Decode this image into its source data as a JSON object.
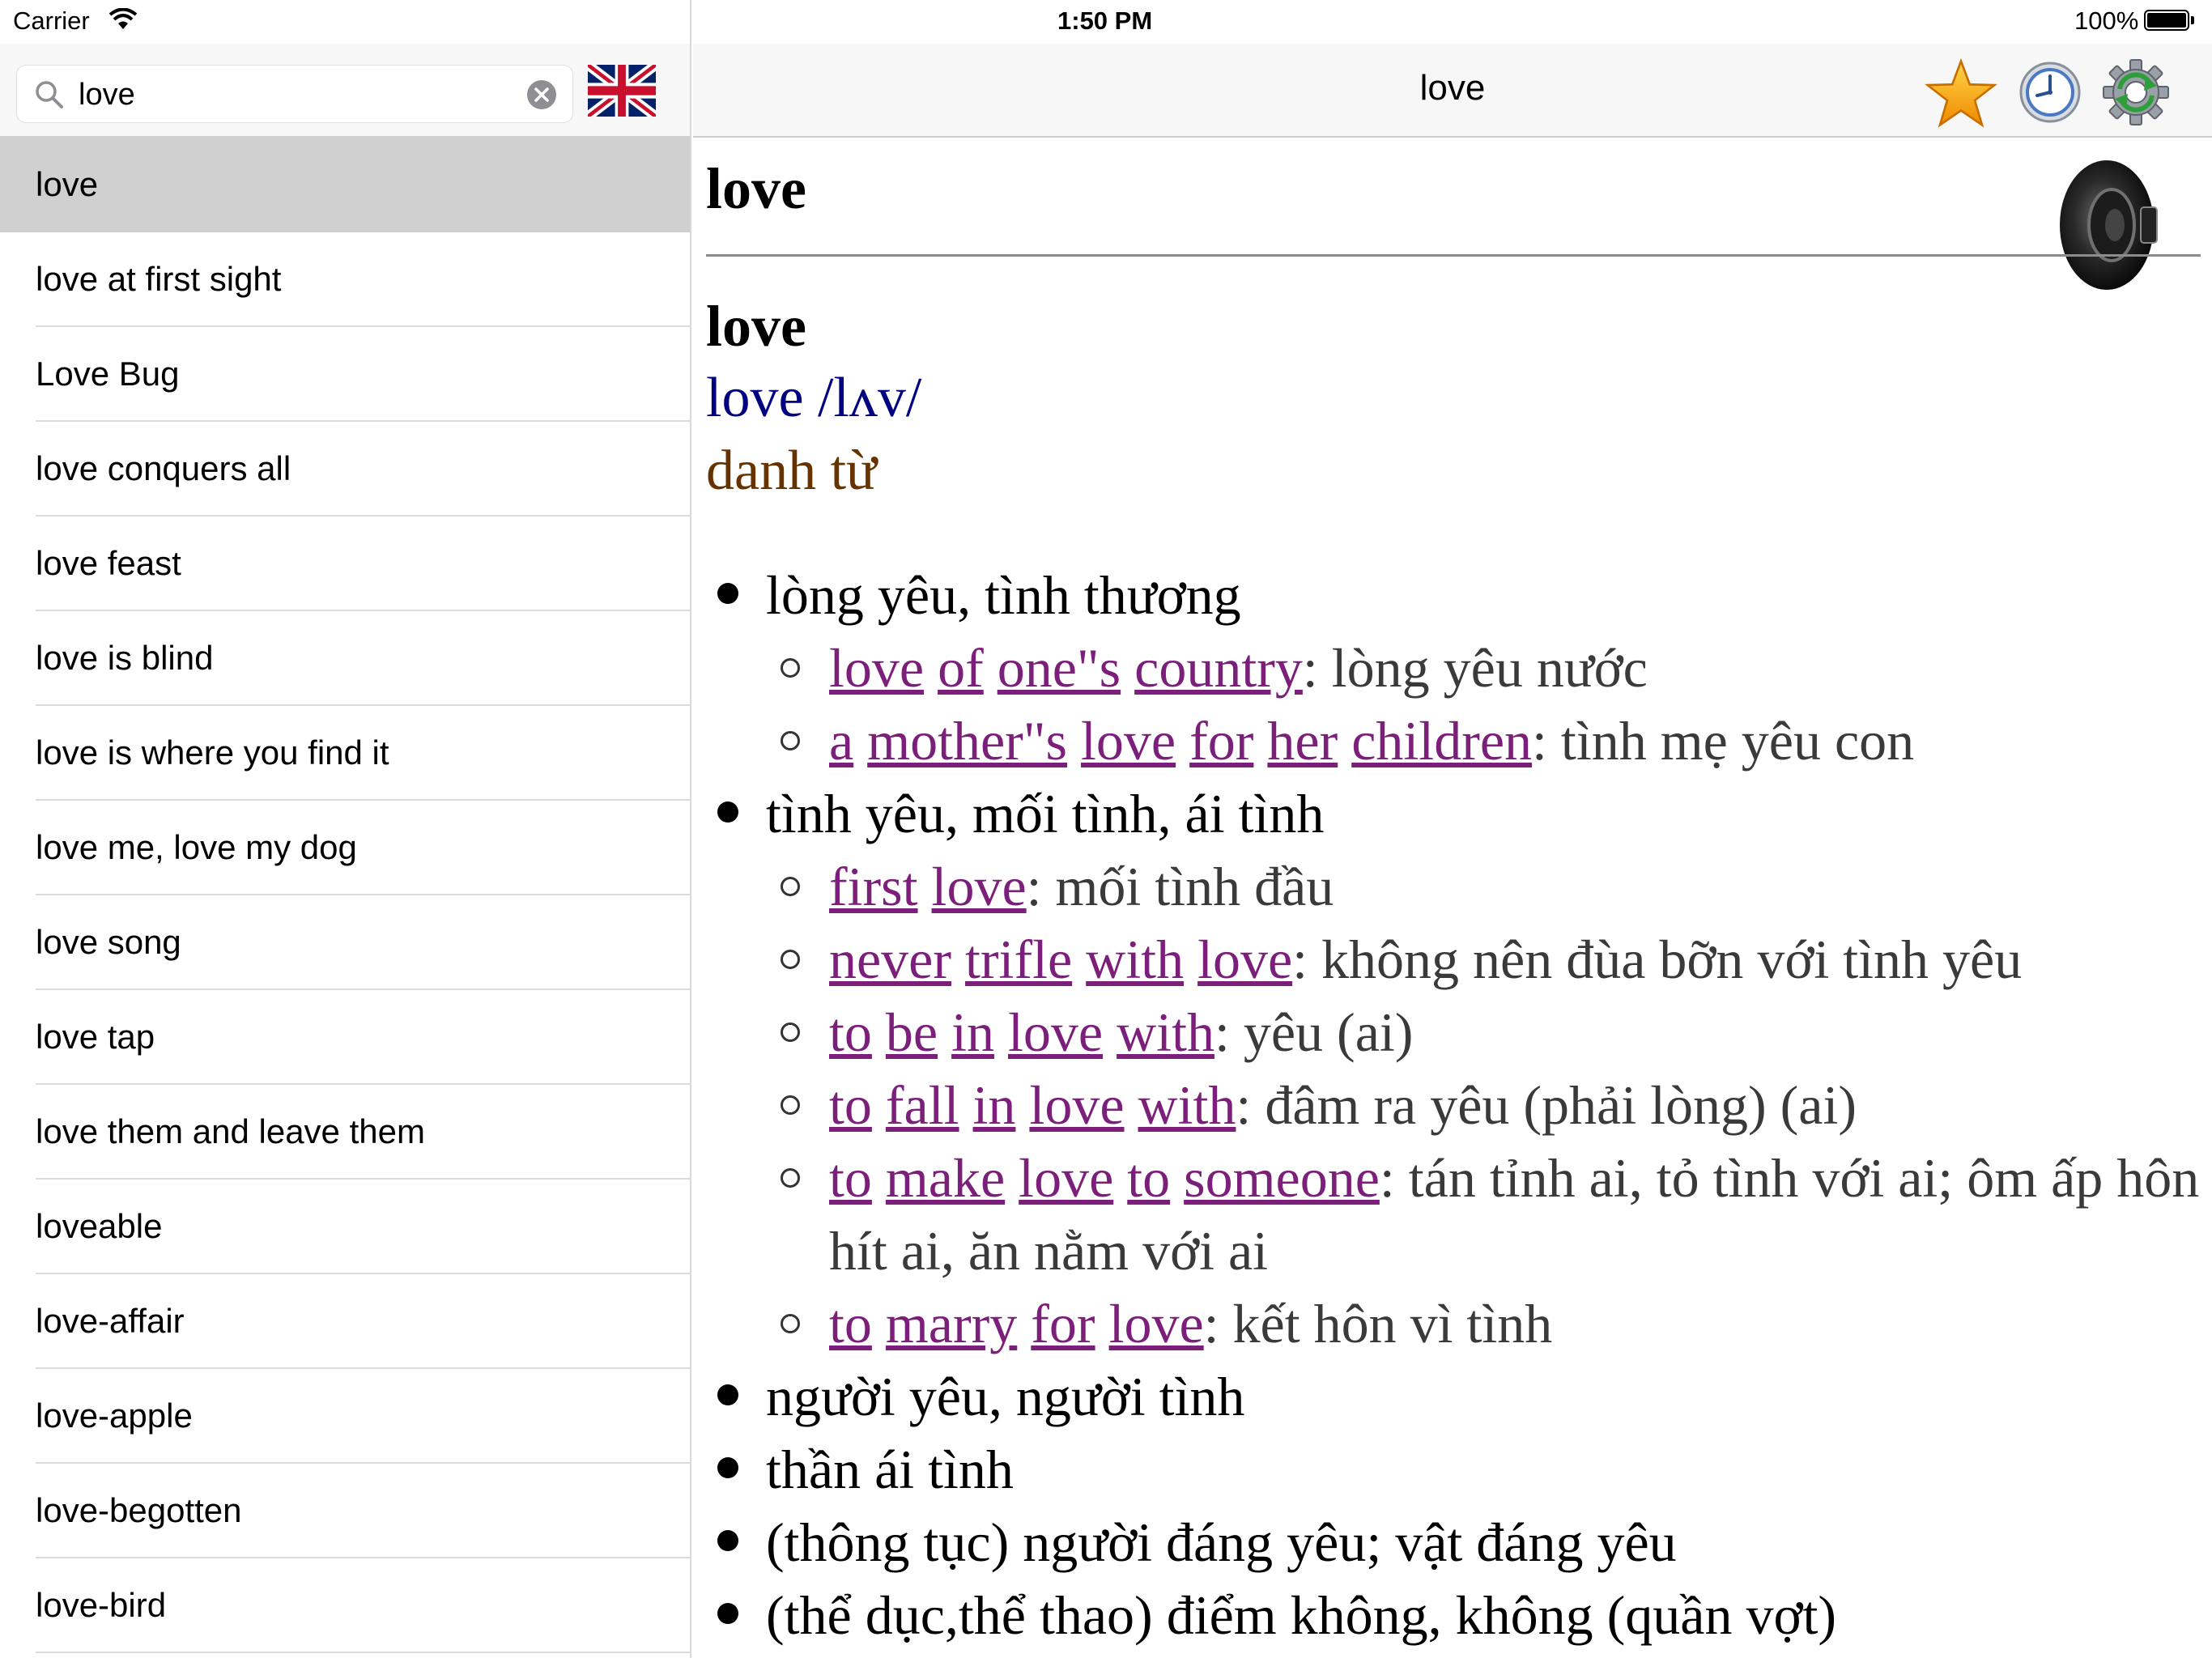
{
  "status_bar": {
    "carrier": "Carrier",
    "time": "1:50 PM",
    "battery": "100%"
  },
  "search": {
    "value": "love",
    "language_flag": "uk-flag-icon"
  },
  "word_list": [
    {
      "label": "love",
      "selected": true
    },
    {
      "label": "love at first sight"
    },
    {
      "label": "Love Bug"
    },
    {
      "label": "love conquers all"
    },
    {
      "label": "love feast"
    },
    {
      "label": "love is blind"
    },
    {
      "label": "love is where you find it"
    },
    {
      "label": "love me, love my dog"
    },
    {
      "label": "love song"
    },
    {
      "label": "love tap"
    },
    {
      "label": "love them and leave them"
    },
    {
      "label": "loveable"
    },
    {
      "label": "love-affair"
    },
    {
      "label": "love-apple"
    },
    {
      "label": "love-begotten"
    },
    {
      "label": "love-bird"
    }
  ],
  "header": {
    "title": "love",
    "icons": [
      "star-icon",
      "history-clock-icon",
      "settings-gear-icon"
    ]
  },
  "definition": {
    "headword": "love",
    "entry_word": "love",
    "pronunciation": "love /lʌv/",
    "part_of_speech": "danh từ",
    "senses": [
      {
        "text": "lòng yêu, tình thương",
        "examples": [
          {
            "links": [
              "love",
              "of",
              "one\"s",
              "country"
            ],
            "translation": ": lòng yêu nước"
          },
          {
            "links": [
              "a",
              "mother\"s",
              "love",
              "for",
              "her",
              "children"
            ],
            "translation": ": tình mẹ yêu con"
          }
        ]
      },
      {
        "text": "tình yêu, mối tình, ái tình",
        "examples": [
          {
            "links": [
              "first",
              "love"
            ],
            "translation": ": mối tình đầu"
          },
          {
            "links": [
              "never",
              "trifle",
              "with",
              "love"
            ],
            "translation": ": không nên đùa bỡn với tình yêu"
          },
          {
            "links": [
              "to",
              "be",
              "in",
              "love",
              "with"
            ],
            "translation": ": yêu (ai)"
          },
          {
            "links": [
              "to",
              "fall",
              "in",
              "love",
              "with"
            ],
            "translation": ": đâm ra yêu (phải lòng) (ai)"
          },
          {
            "links": [
              "to",
              "make",
              "love",
              "to",
              "someone"
            ],
            "translation": ": tán tỉnh ai, tỏ tình với ai; ôm ấp hôn hít ai, ăn nằm với ai"
          },
          {
            "links": [
              "to",
              "marry",
              "for",
              "love"
            ],
            "translation": ": kết hôn vì tình"
          }
        ]
      },
      {
        "text": "người yêu, người tình",
        "examples": []
      },
      {
        "text": "thần ái tình",
        "examples": []
      },
      {
        "text": "(thông tục) người đáng yêu; vật đáng yêu",
        "examples": []
      },
      {
        "text": "(thể dục,thể thao) điểm không, không (quần vợt)",
        "examples": []
      }
    ]
  },
  "colors": {
    "link": "#7b1f7b",
    "pronunciation": "#000080",
    "part_of_speech": "#663300",
    "selected_row": "#d0d0d0"
  }
}
